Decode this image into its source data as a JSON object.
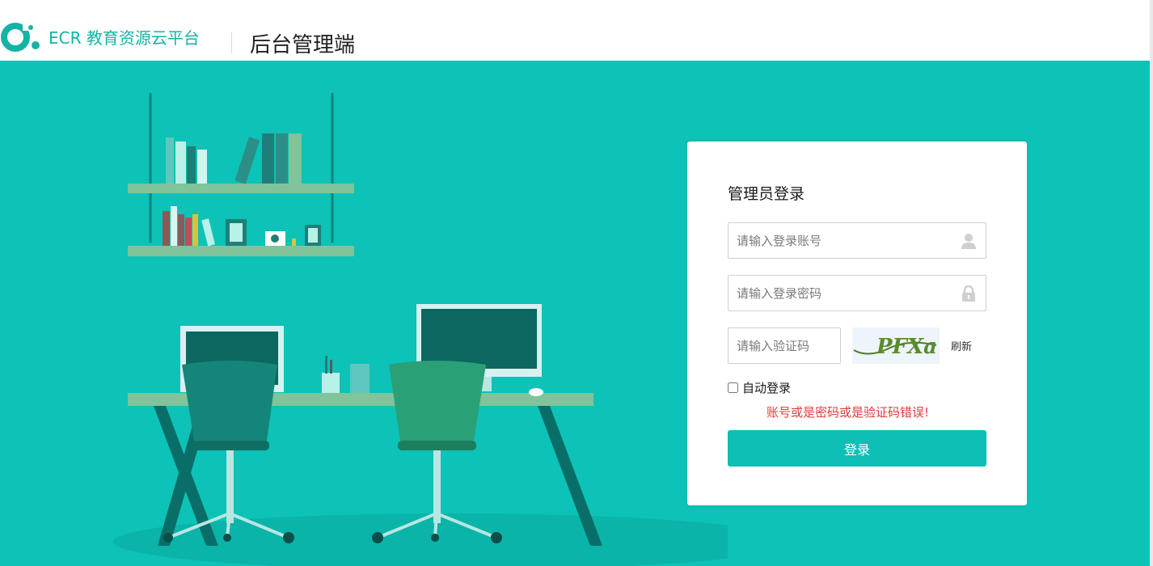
{
  "header": {
    "logo_text": "ECR 教育资源云平台",
    "title": "后台管理端"
  },
  "login": {
    "title": "管理员登录",
    "account_placeholder": "请输入登录账号",
    "password_placeholder": "请输入登录密码",
    "captcha_placeholder": "请输入验证码",
    "captcha_text": "PFXa",
    "refresh_label": "刷新",
    "auto_login_label": "自动登录",
    "auto_login_checked": false,
    "error_message": "账号或是密码或是验证码错误!",
    "submit_label": "登录"
  },
  "colors": {
    "brand": "#14b3a6",
    "background": "#0dc2b7",
    "button": "#0dbfb4",
    "error": "#e4393c"
  },
  "icons": {
    "account": "user-icon",
    "password": "lock-icon"
  }
}
